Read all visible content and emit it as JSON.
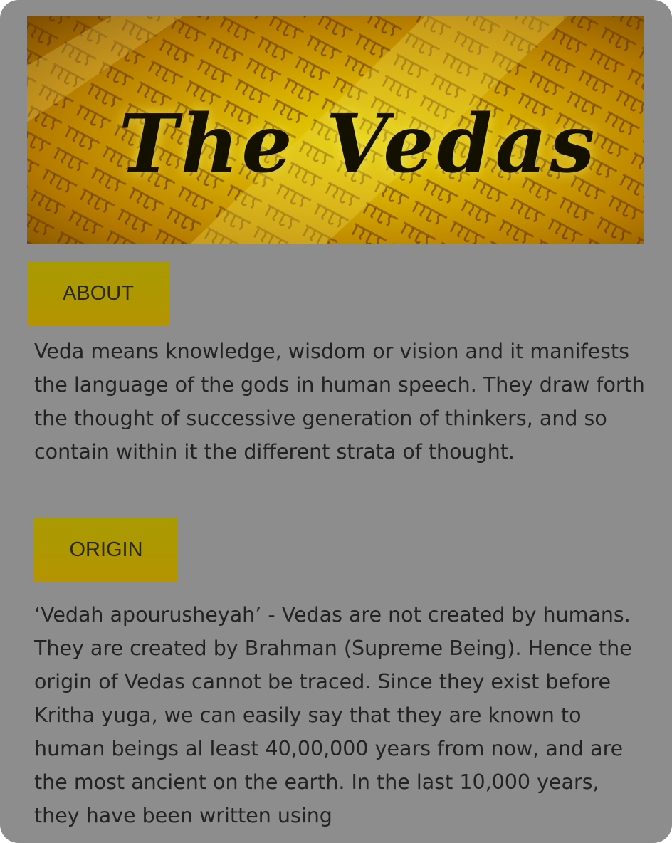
{
  "banner": {
    "title": "The Vedas"
  },
  "sections": [
    {
      "button_label": "ABOUT",
      "text": "Veda means knowledge, wisdom or vision and it manifests the language of the gods in human speech. They draw forth the thought of successive generation of thinkers, and so contain within it the different strata of thought."
    },
    {
      "button_label": "ORIGIN",
      "text": "‘Vedah apourusheyah’ - Vedas are not created by humans. They are created by Brahman (Supreme Being). Hence the origin of Vedas cannot be traced. Since they exist before Kritha yuga, we can easily say that they are known to human beings al least 40,00,000 years from now, and are the most ancient on the earth. In the last 10,000 years, they have been written using"
    }
  ],
  "colors": {
    "overlay_gray": "#8d8d8d",
    "button_gold": "#b09800",
    "banner_gold": "#d4a900",
    "text_dark": "#232323"
  }
}
